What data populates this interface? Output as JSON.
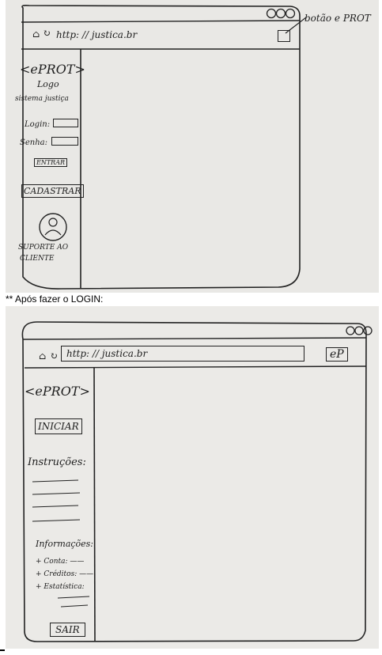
{
  "sketch1": {
    "url": "http: // justica.br",
    "annotation": "botão e PROT",
    "sidebar": {
      "logo": "<ePROT>",
      "logo_caption": "Logo",
      "system_name": "sistema justiça",
      "login_label": "Login:",
      "password_label": "Senha:",
      "enter_button": "ENTRAR",
      "register_button": "CADASTRAR",
      "support_label_1": "SUPORTE AO",
      "support_label_2": "CLIENTE"
    }
  },
  "caption": "** Após fazer o LOGIN:",
  "sketch2": {
    "url": "http: // justica.br",
    "toolbar_button": "eP",
    "sidebar": {
      "logo": "<ePROT>",
      "start_button": "INICIAR",
      "instructions_heading": "Instruções:",
      "information_heading": "Informações:",
      "info_items": [
        "+ Conta: ——",
        "+ Créditos: ——",
        "+ Estatística:"
      ],
      "exit_button": "SAIR"
    }
  }
}
